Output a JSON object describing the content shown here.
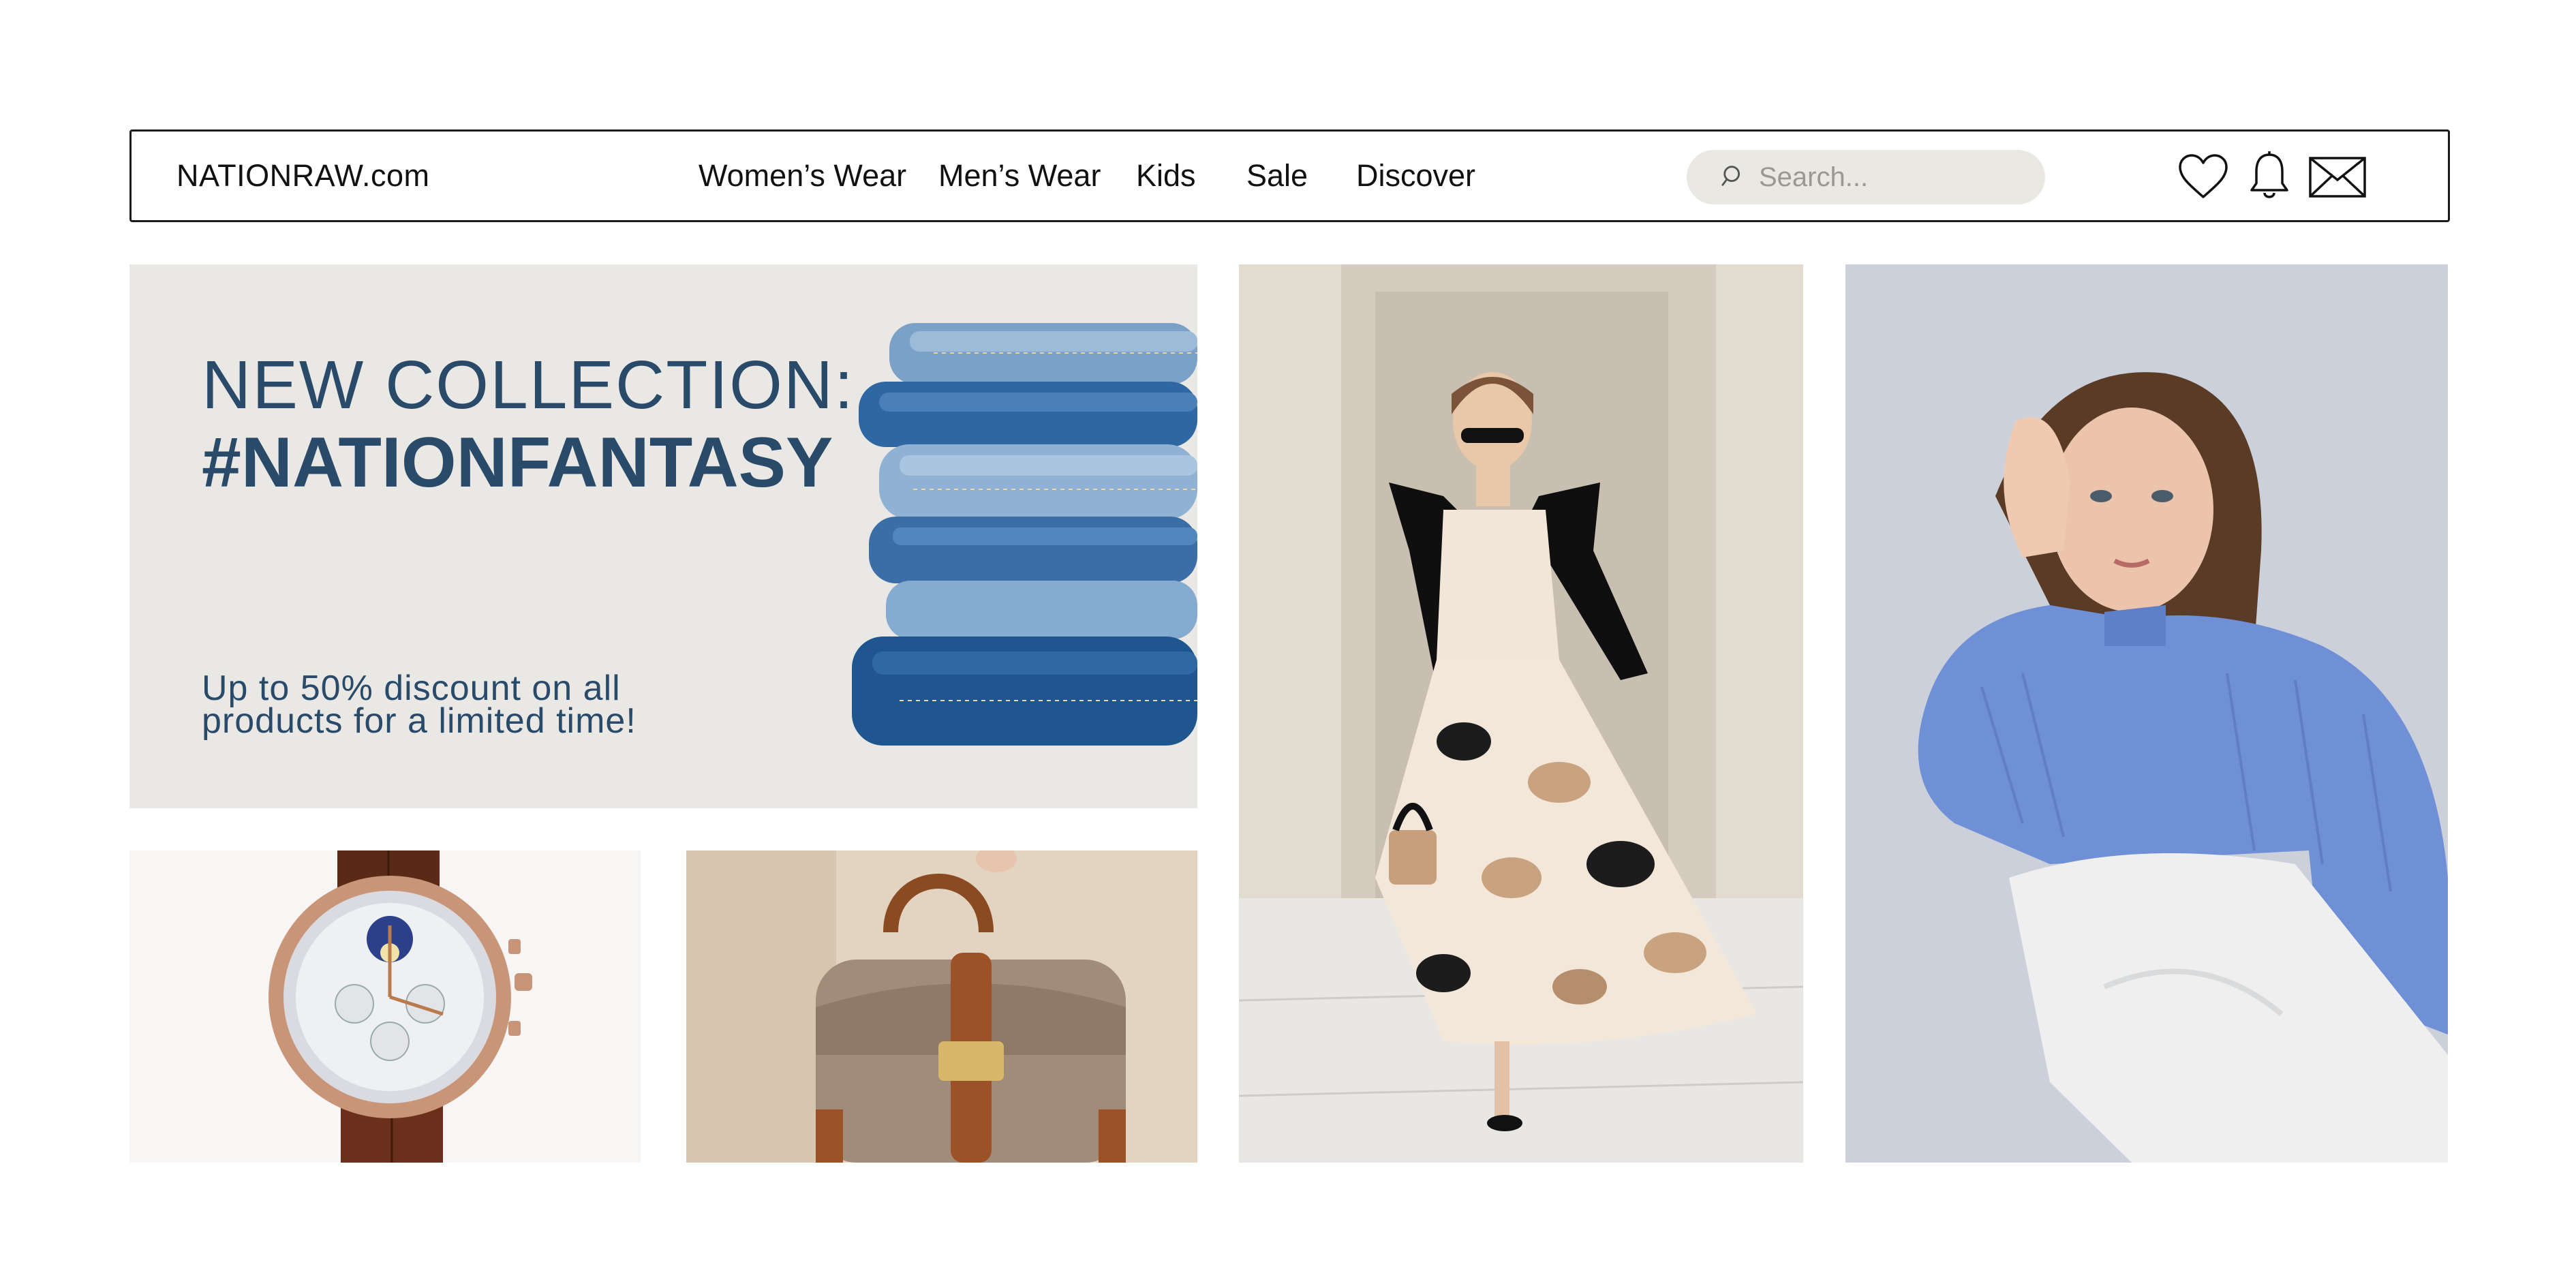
{
  "site": {
    "logo": "NATIONRAW.com"
  },
  "nav": {
    "items": [
      {
        "label": "Women’s Wear"
      },
      {
        "label": "Men’s Wear"
      },
      {
        "label": "Kids"
      },
      {
        "label": "Sale"
      },
      {
        "label": "Discover"
      }
    ]
  },
  "search": {
    "placeholder": "Search...",
    "icon": "search-icon"
  },
  "header_icons": [
    "heart-icon",
    "bell-icon",
    "mail-icon"
  ],
  "hero": {
    "title_line1": "NEW COLLECTION:",
    "title_line2": "#NATIONFANTASY",
    "subtitle": "Up to 50% discount on all products for a limited time!"
  },
  "colors": {
    "brand_navy": "#2a4a69",
    "hero_bg": "#e9e8e4",
    "search_bg": "#e9e8e2",
    "sweater_blue": "#6f8fd6"
  }
}
